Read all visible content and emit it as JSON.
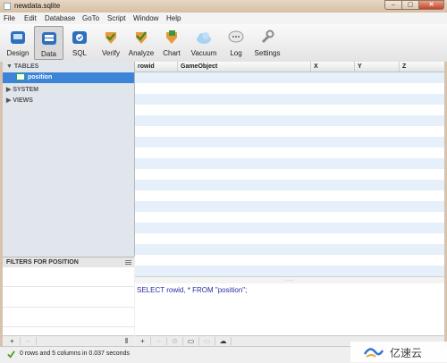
{
  "window": {
    "title": "newdata.sqlite",
    "min": "–",
    "max": "▢",
    "close": "✕"
  },
  "menu": [
    "File",
    "Edit",
    "Database",
    "GoTo",
    "Script",
    "Window",
    "Help"
  ],
  "toolbar": [
    {
      "label": "Design",
      "icon": "design-icon"
    },
    {
      "label": "Data",
      "icon": "data-icon",
      "active": true
    },
    {
      "label": "SQL",
      "icon": "sql-icon"
    },
    {
      "label": "Verify",
      "icon": "verify-icon"
    },
    {
      "label": "Analyze",
      "icon": "analyze-icon"
    },
    {
      "label": "Chart",
      "icon": "chart-icon"
    },
    {
      "label": "Vacuum",
      "icon": "vacuum-icon"
    },
    {
      "label": "Log",
      "icon": "log-icon"
    },
    {
      "label": "Settings",
      "icon": "settings-icon"
    }
  ],
  "sidebar": {
    "tables_header": "▼ TABLES",
    "selected_table": "position",
    "system_header": "▶ SYSTEM",
    "views_header": "▶ VIEWS"
  },
  "filters": {
    "title": "FILTERS FOR POSITION"
  },
  "grid": {
    "columns": [
      "rowid",
      "GameObject",
      "X",
      "Y",
      "Z"
    ]
  },
  "sql": {
    "query": "SELECT rowid, * FROM \"position\";"
  },
  "split_dots": "·····",
  "left_buttons": [
    "+",
    "−",
    "⦀"
  ],
  "right_buttons": [
    "+",
    "−",
    "⊘",
    "▭",
    "▭",
    "☁"
  ],
  "status": {
    "text": "0 rows and 5 columns in 0.037 seconds"
  },
  "watermark": {
    "text": "亿速云"
  }
}
